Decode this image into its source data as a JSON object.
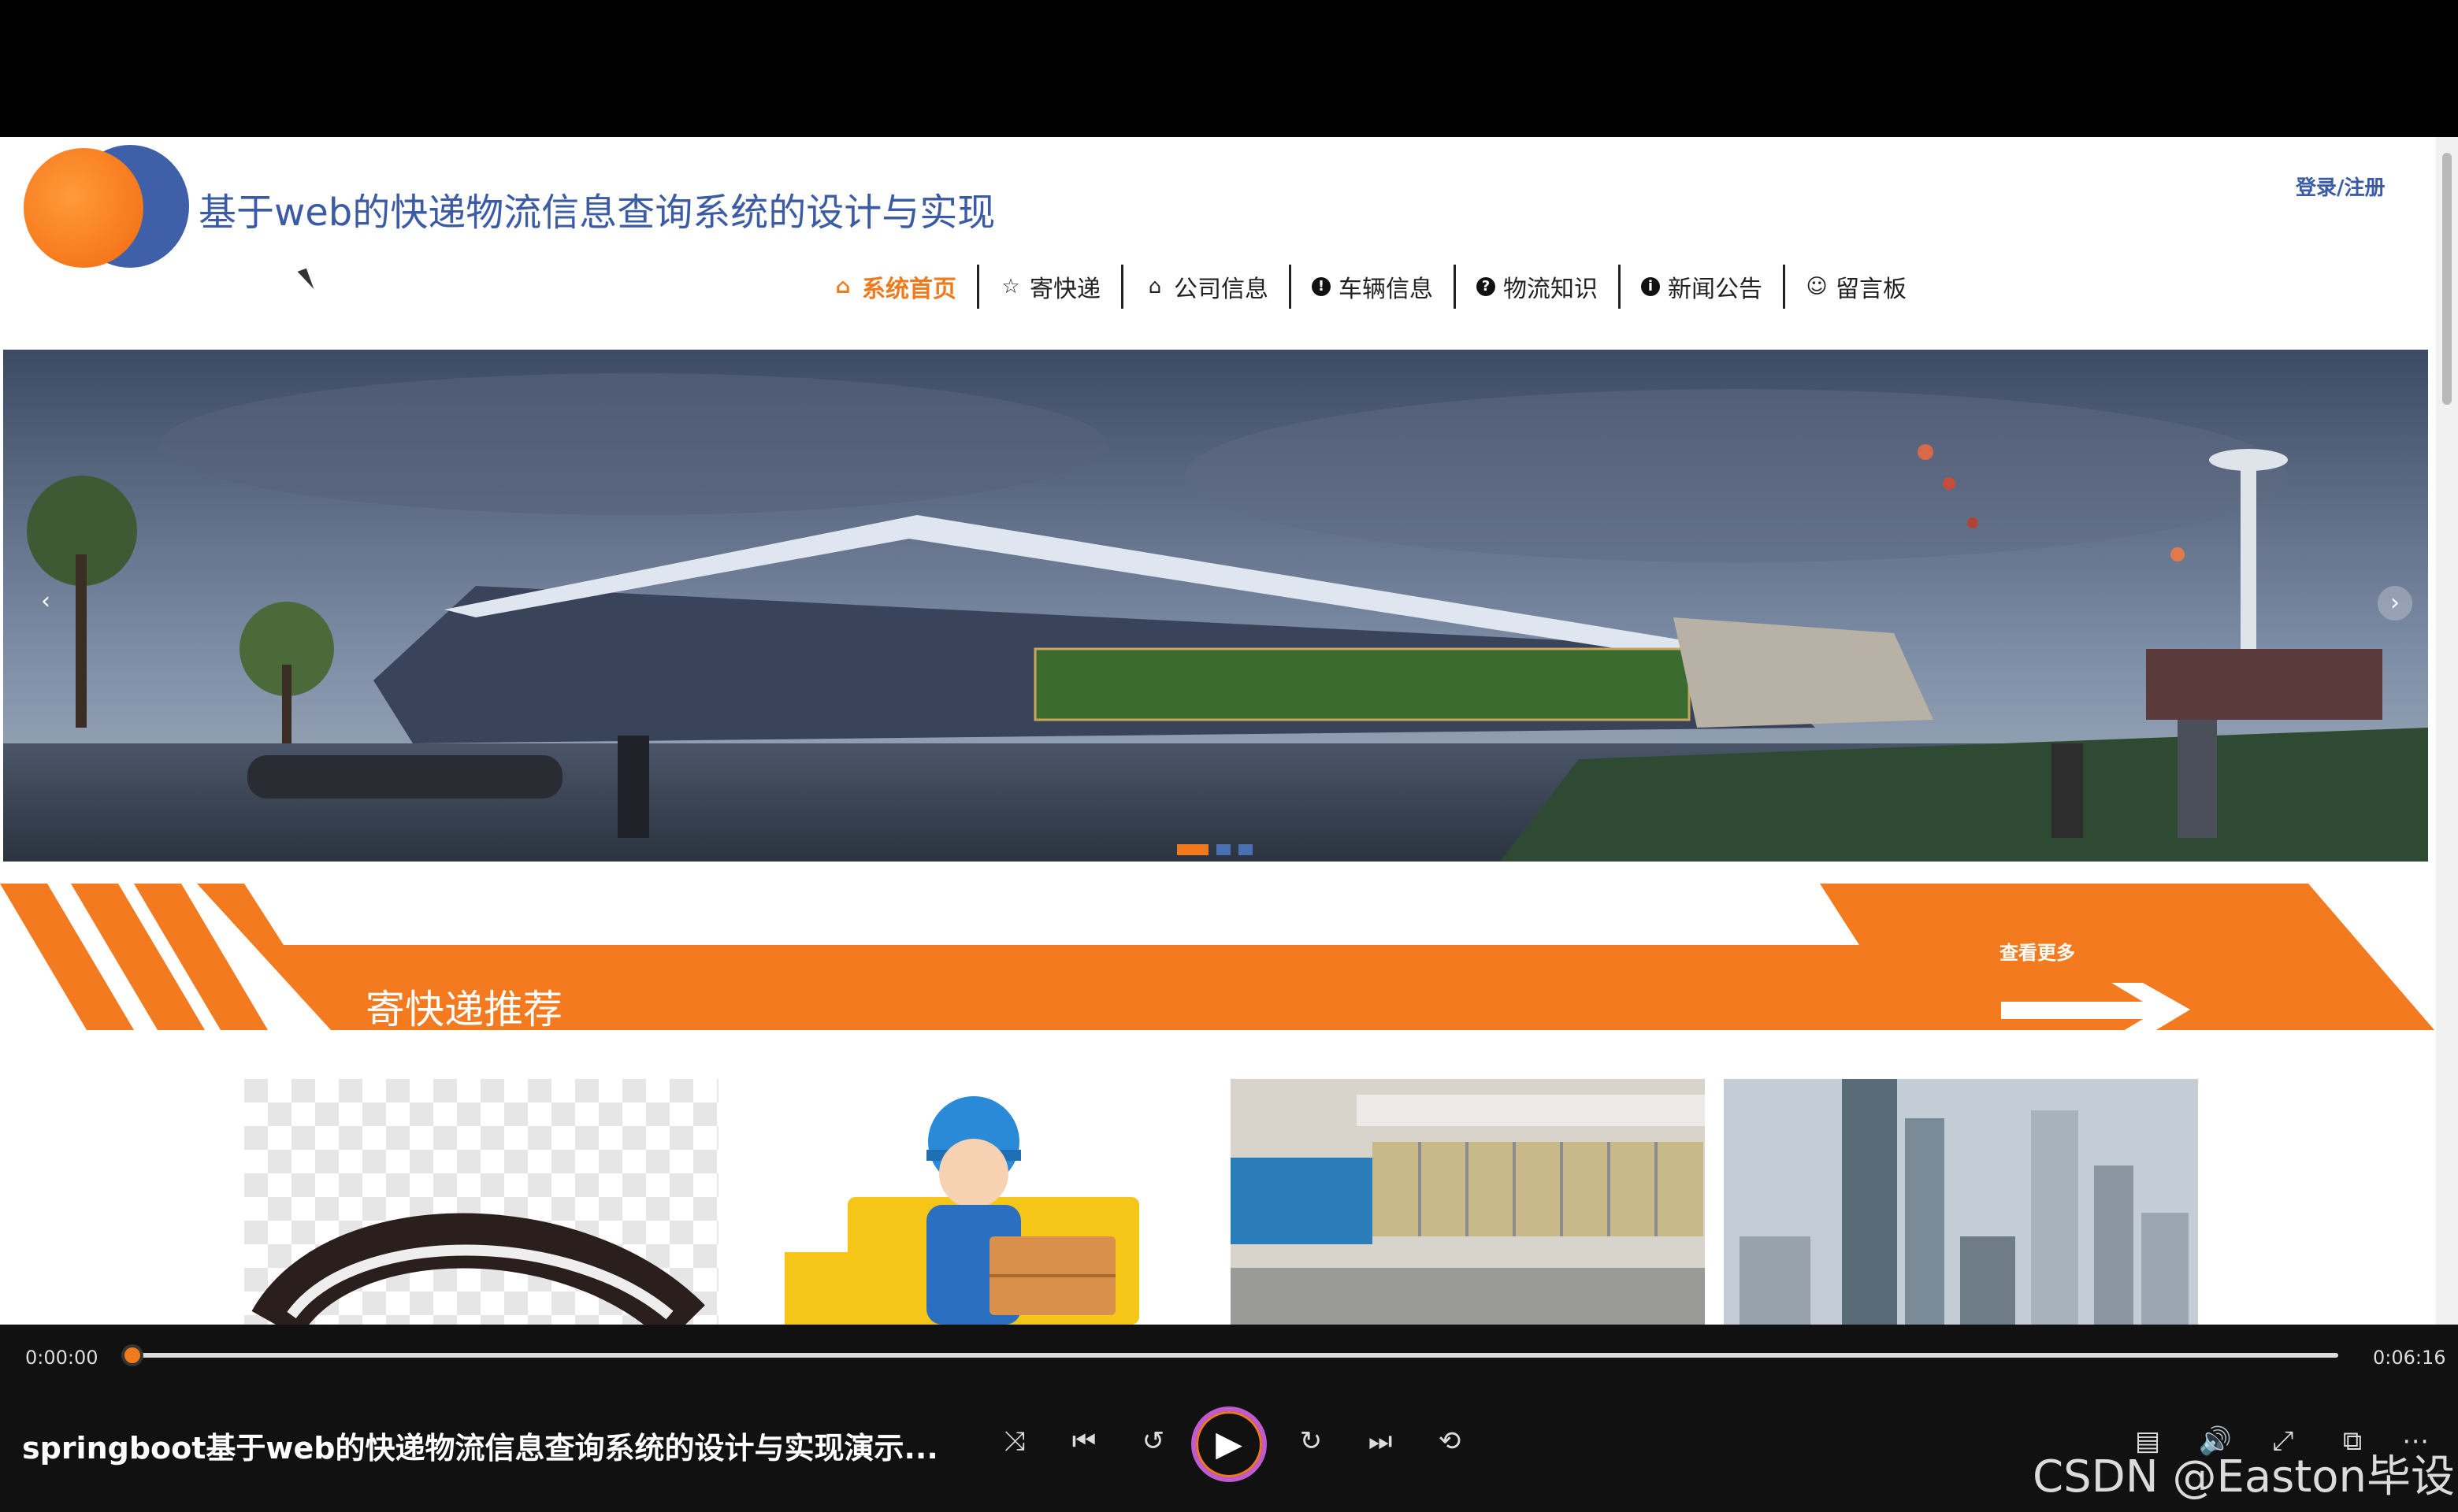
{
  "header": {
    "title": "基于web的快递物流信息查询系统的设计与实现",
    "login_link": "登录/注册"
  },
  "nav": {
    "items": [
      {
        "label": "系统首页",
        "icon": "home-icon",
        "active": true
      },
      {
        "label": "寄快递",
        "icon": "star-icon"
      },
      {
        "label": "公司信息",
        "icon": "bag-icon"
      },
      {
        "label": "车辆信息",
        "icon": "exclamation-icon"
      },
      {
        "label": "物流知识",
        "icon": "question-icon"
      },
      {
        "label": "新闻公告",
        "icon": "info-icon"
      },
      {
        "label": "留言板",
        "icon": "smile-icon"
      }
    ]
  },
  "banner": {
    "prev_glyph": "‹",
    "next_glyph": "›",
    "slides": 3,
    "active_slide": 1
  },
  "section": {
    "title": "寄快递推荐",
    "more_label": "查看更多"
  },
  "player": {
    "current_time": "0:00:00",
    "total_time": "0:06:16",
    "progress": 0,
    "video_title": "springboot基于web的快递物流信息查询系统的设计与实现演示...",
    "shuffle_glyph": "⤨",
    "prev_glyph": "⏮",
    "rewind_glyph": "↺",
    "play_glyph": "▶",
    "forward_glyph": "↻",
    "next_glyph": "⏭",
    "repeat_glyph": "⟲",
    "subtitle_glyph": "▤",
    "volume_glyph": "🔊",
    "fullscreen_glyph": "⤢",
    "miniplayer_glyph": "⧉",
    "more_glyph": "⋯"
  },
  "watermark": "CSDN @Easton毕设",
  "colors": {
    "accent": "#f07a1b",
    "brand_blue": "#3b5ba5"
  }
}
